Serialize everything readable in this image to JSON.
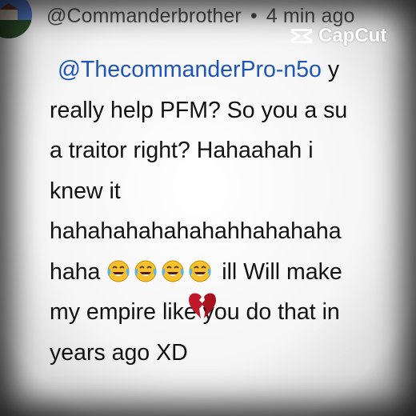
{
  "comment": {
    "author": "@Commanderbrother",
    "separator": "•",
    "time": "4 min ago",
    "lines": [
      {
        "mention": "@ThecommanderPro-n5o",
        "text": " y"
      },
      {
        "text": "really help PFM? So you a su"
      },
      {
        "text": "a traitor right? Hahaahah i"
      },
      {
        "text": "knew it"
      },
      {
        "text": "hahahahahahahahhahahaha"
      },
      {
        "text_before_emoji": "haha ",
        "emoji_count": 4,
        "emoji": "laughing-crying-face",
        "text_after_emoji": " ill Will make"
      },
      {
        "text": "my empire like you do that in"
      },
      {
        "text": "years ago XD"
      }
    ]
  },
  "watermark": {
    "label": "CapCut",
    "icon": "capcut-logo-icon"
  },
  "overlay": {
    "icon": "broken-heart-icon",
    "color": "#c0182a"
  },
  "colors": {
    "mention": "#1f55b8",
    "text": "#111111",
    "header": "#4a4a4a"
  }
}
